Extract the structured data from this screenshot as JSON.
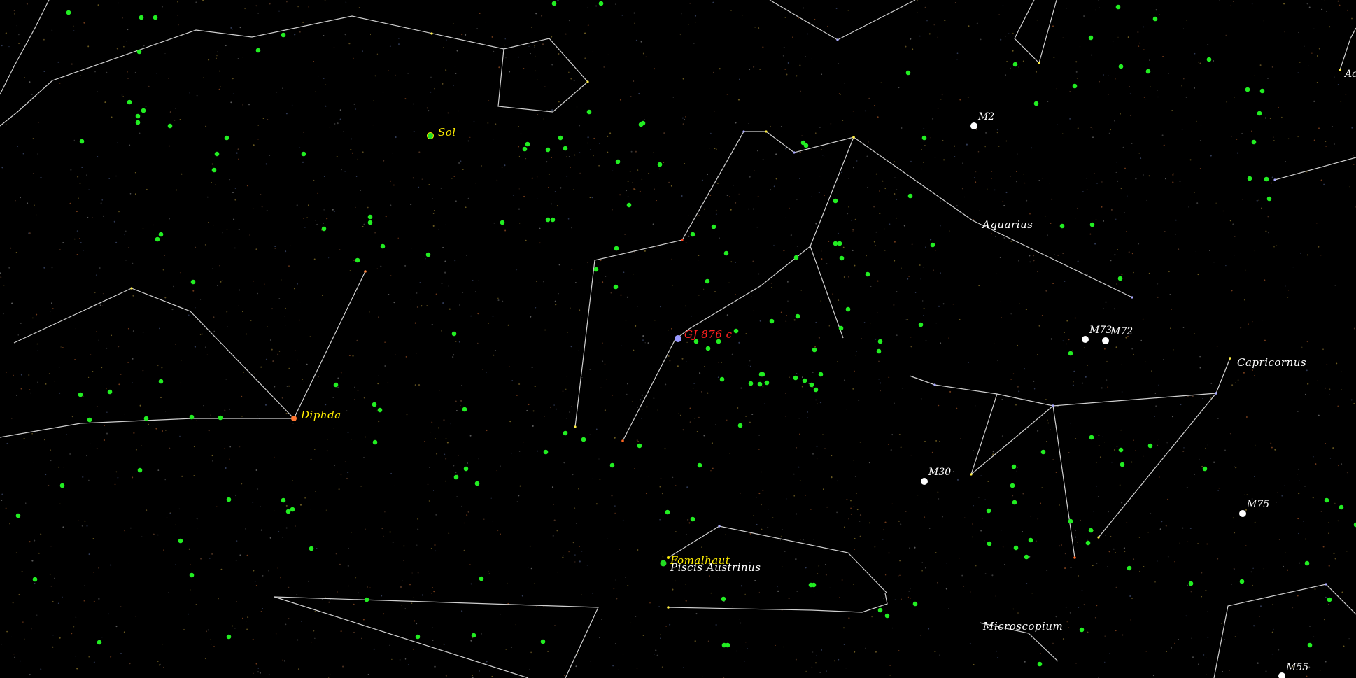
{
  "colors": {
    "background": "#000000",
    "constellation_line": "#d8d8d8",
    "exoplanet_host": "#22ee22",
    "messier": "#ffffff",
    "bright_star_label": "#ffee00",
    "target_label": "#ff2020",
    "constellation_label": "#ffffff"
  },
  "labels": {
    "sol": "Sol",
    "diphda": "Diphda",
    "fomalhaut": "Fomalhaut",
    "target": "GJ 876 c",
    "aquarius": "Aquarius",
    "capricornus": "Capricornus",
    "piscis_austrinus": "Piscis Austrinus",
    "microscopium": "Microscopium",
    "m2": "M2",
    "m30": "M30",
    "m72": "M72",
    "m73": "M73",
    "m75": "M75",
    "m55": "M55",
    "edge_label": "Ac"
  },
  "icons": {
    "exoplanet_host": "green-dot",
    "messier_object": "white-disc",
    "selected_target": "lavender-disc"
  }
}
